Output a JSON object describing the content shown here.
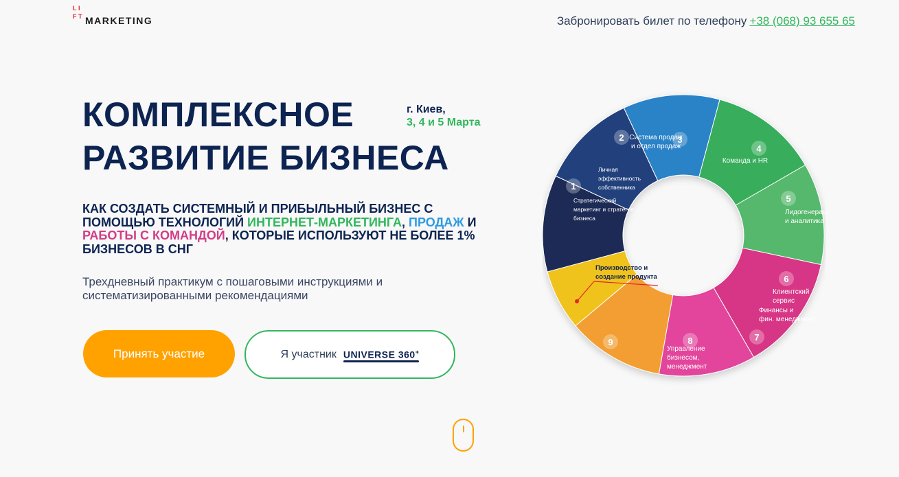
{
  "logo": {
    "mark_letters": [
      "L",
      "I",
      "F",
      "T"
    ],
    "text": "MARKETING"
  },
  "header": {
    "phone_label": "Забронировать билет по телефону",
    "phone_number": "+38 (068) 93 655 65"
  },
  "hero": {
    "title_line1": "КОМПЛЕКСНОЕ",
    "title_line2": "РАЗВИТИЕ БИЗНЕСА",
    "city": "г. Киев,",
    "dates": "3, 4 и 5 Марта",
    "subtitle": {
      "p1": "КАК СОЗДАТЬ СИСТЕМНЫЙ И ПРИБЫЛЬНЫЙ БИЗНЕС С ПОМОЩЬЮ ТЕХНОЛОГИЙ ",
      "h1": "ИНТЕРНЕТ-МАРКЕТИНГА",
      "p2": ", ",
      "h2": "ПРОДАЖ",
      "p3": " И ",
      "h3": "РАБОТЫ С КОМАНДОЙ",
      "p4": ", КОТОРЫЕ ИСПОЛЬЗУЮТ НЕ БОЛЕЕ 1% БИЗНЕСОВ В СНГ"
    },
    "description": "Трехдневный практикум с пошаговыми инструкциями и систематизированными рекомендациями",
    "primary_button": "Принять участие",
    "secondary_button": "Я участник",
    "secondary_brand": "UNIVERSE 360",
    "secondary_brand_sup": "+"
  },
  "wheel": {
    "segments": [
      {
        "num": "1",
        "lines": [
          "Стратегический",
          "маркетинг и стратегия",
          "бизнеса"
        ],
        "color": "#1c2b55"
      },
      {
        "num": "2",
        "lines": [
          "Личная",
          "эффективность",
          "собственника"
        ],
        "color": "#203f7c"
      },
      {
        "num": "3",
        "lines": [
          "Система продаж",
          "и отдел продаж"
        ],
        "color": "#2c82c7"
      },
      {
        "num": "4",
        "lines": [
          "Команда и HR"
        ],
        "color": "#37ad5b"
      },
      {
        "num": "5",
        "lines": [
          "Лидогенерация",
          "и аналитика"
        ],
        "color": "#55b86c"
      },
      {
        "num": "6",
        "lines": [
          "Клиентский",
          "сервис"
        ],
        "color": "#d73685"
      },
      {
        "num": "7",
        "lines": [
          "Финансы и",
          "фин. менеджмент"
        ],
        "color": "#e2449b"
      },
      {
        "num": "8",
        "lines": [
          "Управление",
          "бизнесом,",
          "менеджмент"
        ],
        "color": "#f29e30"
      },
      {
        "num": "9",
        "lines": [],
        "color": "#f0c21f"
      }
    ],
    "callout": [
      "Производство и",
      "создание продукта"
    ]
  }
}
